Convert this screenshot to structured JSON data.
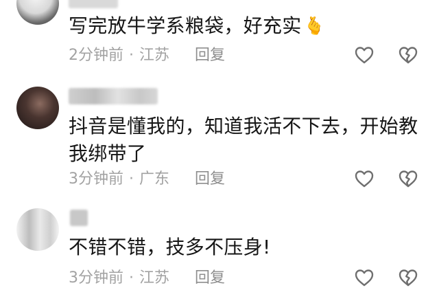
{
  "comments": [
    {
      "text": "写完放牛学系粮袋，好充实",
      "emoji": "🫰",
      "time": "2分钟前",
      "location": "江苏",
      "reply_label": "回复"
    },
    {
      "text_line_1": "抖音是懂我的，知道我活不下去，开始教",
      "text_line_2": "我绑带了",
      "time": "3分钟前",
      "location": "广东",
      "reply_label": "回复"
    },
    {
      "text": "不错不错，技多不压身!",
      "time": "3分钟前",
      "location": "江苏",
      "reply_label": "回复"
    }
  ],
  "separator": "·",
  "icons": {
    "like": "heart-outline-icon",
    "dislike": "broken-heart-icon"
  },
  "colors": {
    "text": "#161616",
    "meta": "#a2a2a2",
    "icon": "#6f6f6f"
  }
}
